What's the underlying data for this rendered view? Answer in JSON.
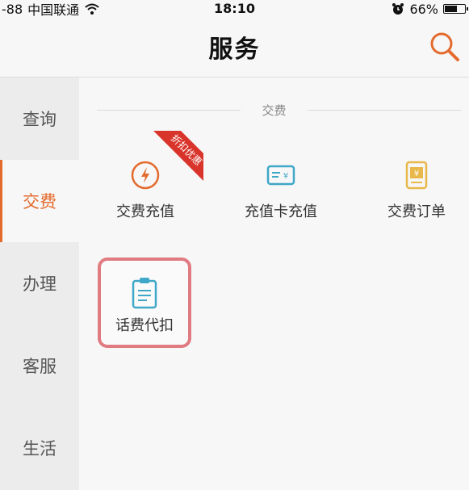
{
  "status_bar": {
    "signal": "-88",
    "carrier": "中国联通",
    "time": "18:10",
    "battery_percent": "66%",
    "battery_level": 0.66
  },
  "nav": {
    "title": "服务"
  },
  "sidebar": {
    "items": [
      {
        "label": "查询",
        "active": false
      },
      {
        "label": "交费",
        "active": true
      },
      {
        "label": "办理",
        "active": false
      },
      {
        "label": "客服",
        "active": false
      },
      {
        "label": "生活",
        "active": false
      }
    ]
  },
  "section": {
    "title": "交费",
    "tiles": [
      {
        "label": "交费充值",
        "icon": "lightning-circle-icon",
        "badge": "折扣优惠"
      },
      {
        "label": "充值卡充值",
        "icon": "card-yuan-icon"
      },
      {
        "label": "交费订单",
        "icon": "order-doc-icon"
      },
      {
        "label": "话费代扣",
        "icon": "clipboard-icon",
        "highlighted": true
      }
    ]
  },
  "colors": {
    "accent": "#e46b2e",
    "ribbon": "#d9342b",
    "highlight": "#e07b82",
    "card_icon": "#3fa7c7",
    "order_icon": "#e9b84a"
  }
}
